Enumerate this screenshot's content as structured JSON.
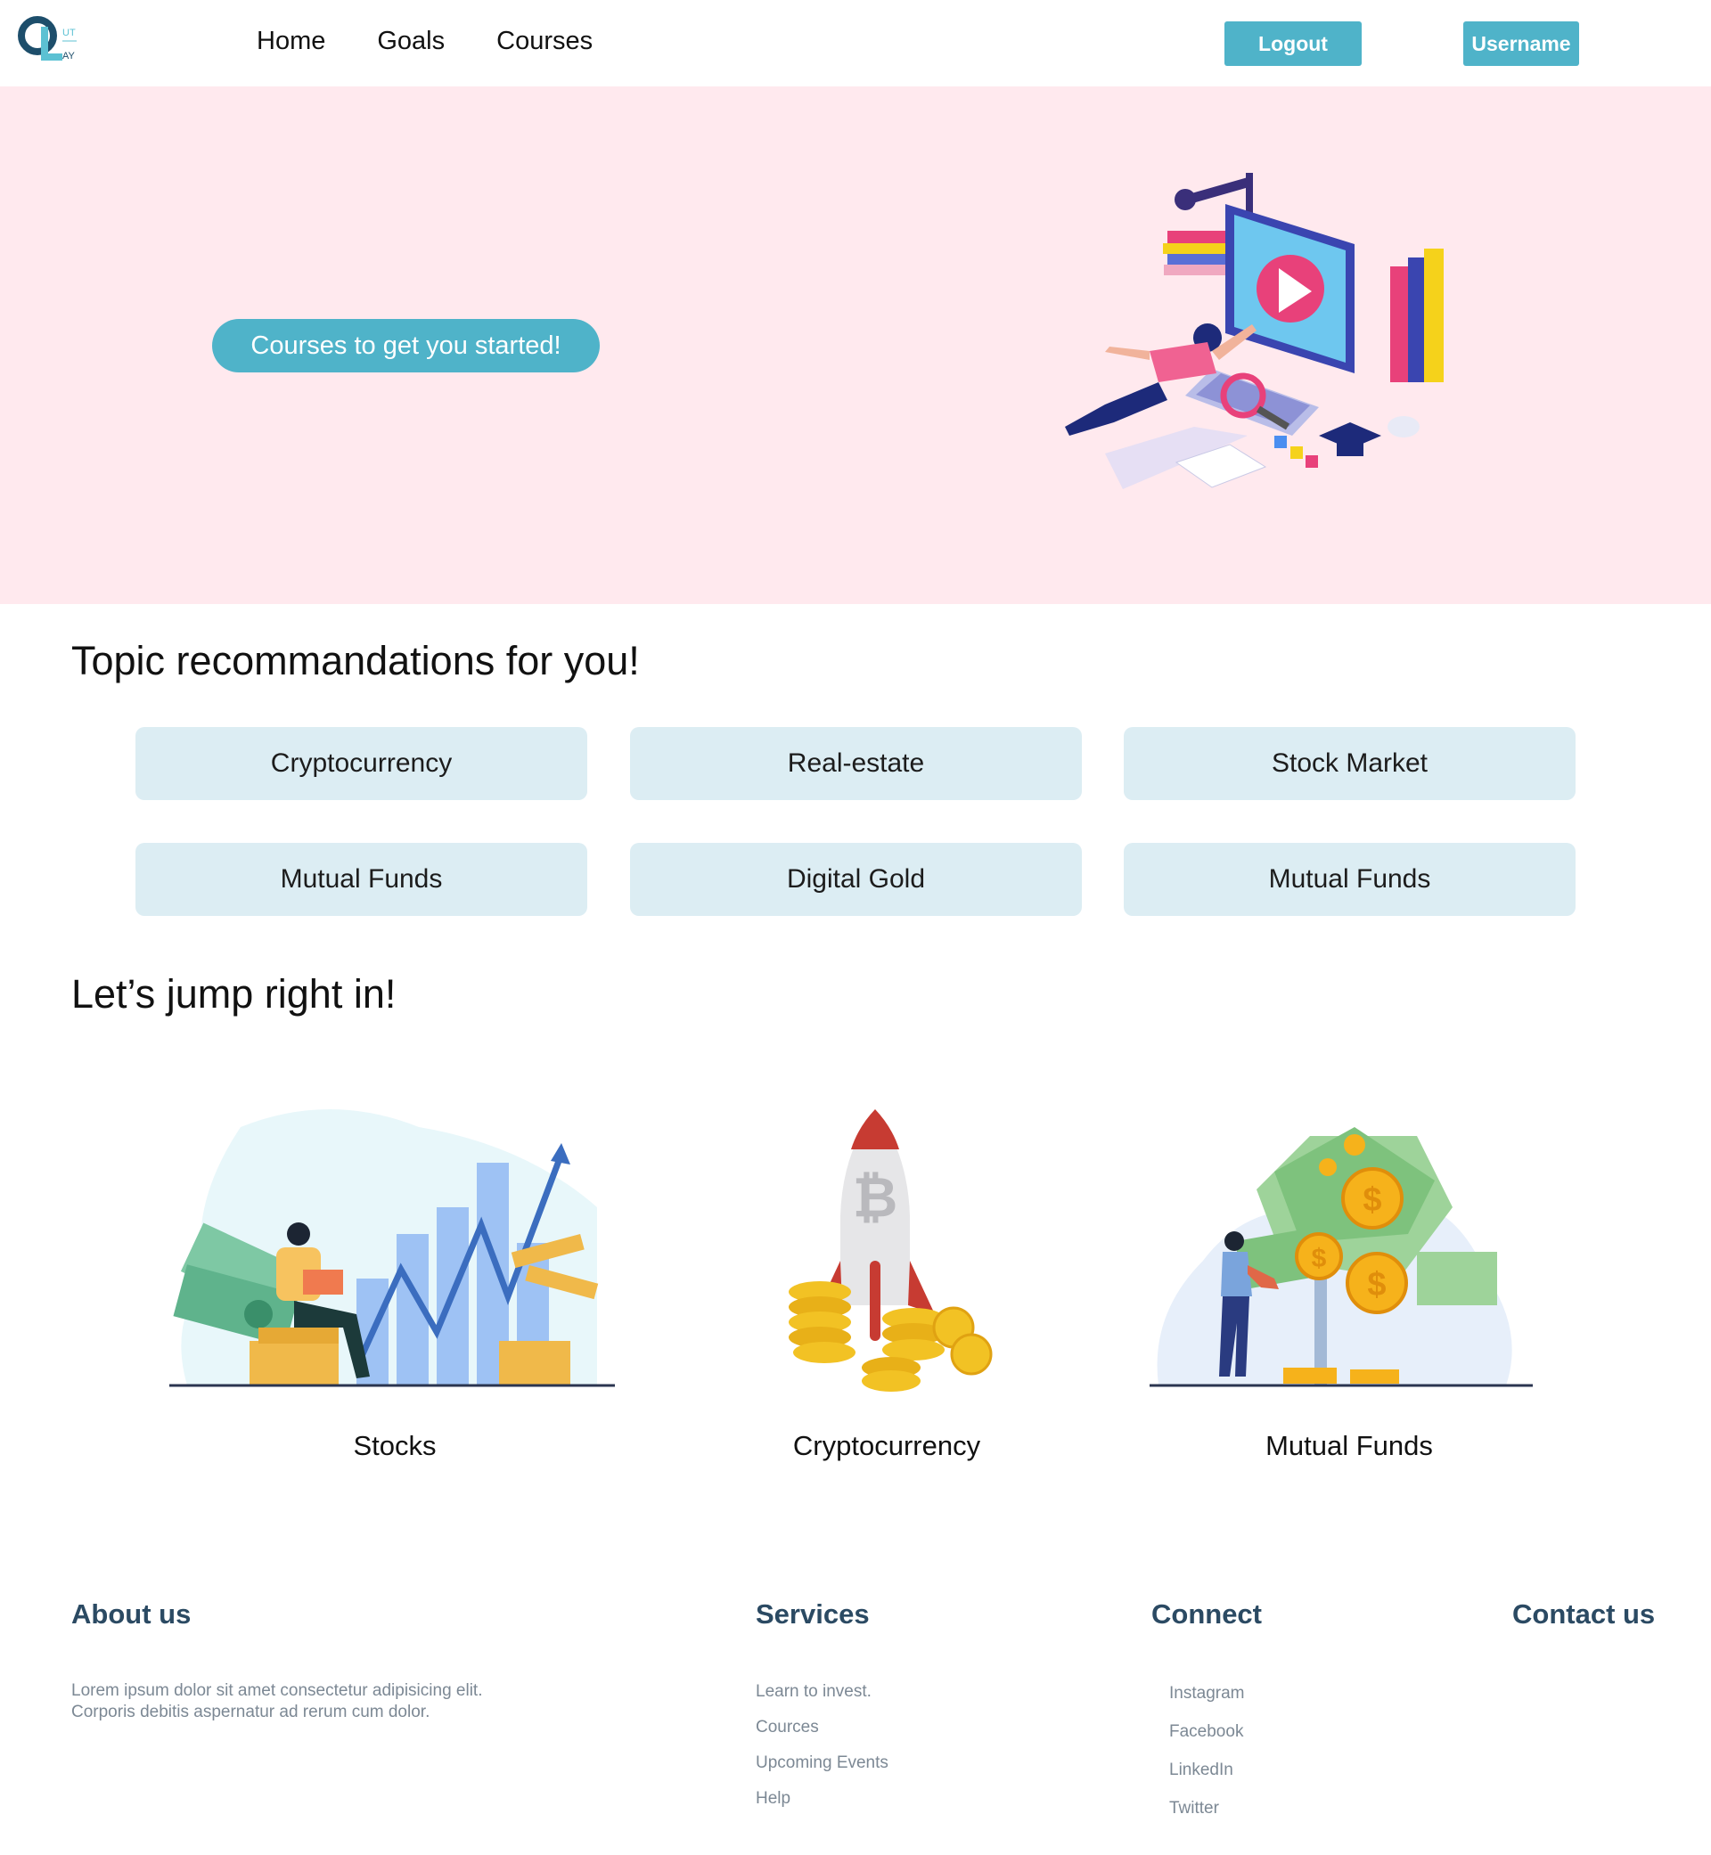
{
  "nav": {
    "logo_letters": "Q L",
    "logo_small": "UT AY",
    "links": [
      "Home",
      "Goals",
      "Courses"
    ],
    "logout_label": "Logout",
    "username_label": "Username",
    "accent": "#4fb3c9"
  },
  "hero": {
    "cta_label": "Courses to get you started!",
    "background": "#ffe9ee"
  },
  "topics": {
    "title": "Topic recommandations for you!",
    "items": [
      "Cryptocurrency",
      "Real-estate",
      "Stock Market",
      "Mutual Funds",
      "Digital Gold",
      "Mutual Funds"
    ]
  },
  "jump": {
    "title": "Let’s jump right in!",
    "cards": [
      "Stocks",
      "Cryptocurrency",
      "Mutual Funds"
    ]
  },
  "footer": {
    "about": {
      "heading": "About us",
      "line1": "Lorem ipsum dolor sit amet consectetur adipisicing elit.",
      "line2": "Corporis debitis aspernatur ad rerum cum dolor."
    },
    "services": {
      "heading": "Services",
      "links": [
        "Learn to invest.",
        "Cources",
        "Upcoming Events",
        "Help"
      ]
    },
    "connect": {
      "heading": "Connect",
      "links": [
        "Instagram",
        "Facebook",
        "LinkedIn",
        "Twitter"
      ]
    },
    "contact": {
      "heading": "Contact us"
    }
  }
}
